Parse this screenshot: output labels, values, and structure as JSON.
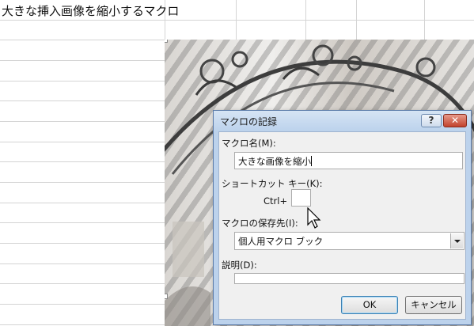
{
  "sheet": {
    "title_cell": "大きな挿入画像を縮小するマクロ"
  },
  "dialog": {
    "title": "マクロの記録",
    "help_button": "?",
    "close_button": "✕",
    "macro_name_label": "マクロ名(M):",
    "macro_name_value": "大きな画像を縮小",
    "shortcut_label": "ショートカット キー(K):",
    "ctrl_prefix": "Ctrl+",
    "shortcut_value": "",
    "store_in_label": "マクロの保存先(I):",
    "store_in_value": "個人用マクロ ブック",
    "description_label": "説明(D):",
    "description_value": "",
    "ok_button": "OK",
    "cancel_button": "キャンセル"
  }
}
